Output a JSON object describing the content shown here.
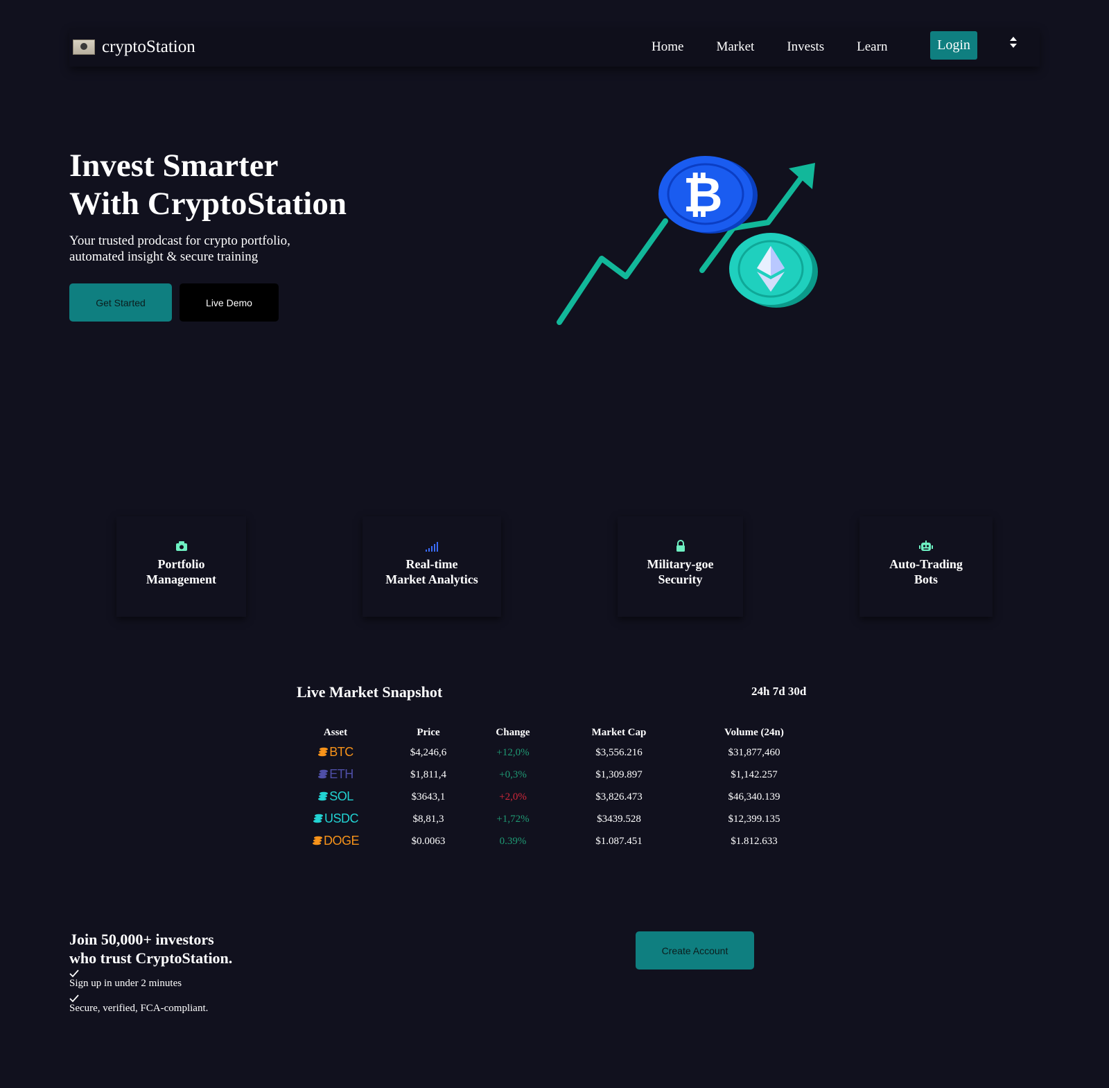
{
  "nav": {
    "brand": "cryptoStation",
    "links": [
      "Home",
      "Market",
      "Invests",
      "Learn"
    ],
    "login": "Login"
  },
  "hero": {
    "title_line1": "Invest Smarter",
    "title_line2": "With CryptoStation",
    "subtitle": "Your trusted prodcast for crypto portfolio, automated insight & secure training",
    "btn_started": "Get Started",
    "btn_demo": "Live Demo"
  },
  "features": [
    {
      "icon": "camera-icon",
      "line1": "Portfolio",
      "line2": "Management"
    },
    {
      "icon": "signal-bars-icon",
      "line1": "Real-time",
      "line2": "Market Analytics"
    },
    {
      "icon": "lock-icon",
      "line1": "Military-goe",
      "line2": "Security"
    },
    {
      "icon": "robot-icon",
      "line1": "Auto-Trading",
      "line2": "Bots"
    }
  ],
  "market": {
    "title": "Live Market Snapshot",
    "ranges": "24h 7d 30d",
    "headers": [
      "Asset",
      "Price",
      "Change",
      "Market Cap",
      "Volume (24n)"
    ],
    "rows": [
      {
        "asset": "BTC",
        "color": "#f7931a",
        "price": "$4,246,6",
        "change": "+12,0%",
        "dir": "pos",
        "mcap": "$3,556.216",
        "volume": "$31,877,460"
      },
      {
        "asset": "ETH",
        "color": "#4f4fa8",
        "price": "$1,811,4",
        "change": "+0,3%",
        "dir": "pos",
        "mcap": "$1,309.897",
        "volume": "$1,142.257"
      },
      {
        "asset": "SOL",
        "color": "#22d3d3",
        "price": "$3643,1",
        "change": "+2,0%",
        "dir": "neg",
        "mcap": "$3,826.473",
        "volume": "$46,340.139"
      },
      {
        "asset": "USDC",
        "color": "#22d3d3",
        "price": "$8,81,3",
        "change": "+1,72%",
        "dir": "pos",
        "mcap": "$3439.528",
        "volume": "$12,399.135"
      },
      {
        "asset": "DOGE",
        "color": "#f7931a",
        "price": "$0.0063",
        "change": "0.39%",
        "dir": "pos",
        "mcap": "$1.087.451",
        "volume": "$1.812.633"
      }
    ]
  },
  "cta": {
    "title_line1": "Join 50,000+ investors",
    "title_line2": "who trust CryptoStation.",
    "check1": "Sign up in under 2 minutes",
    "check2": "Secure, verified, FCA-compliant.",
    "btn_create": "Create Account"
  },
  "colors": {
    "background": "#11111e",
    "accent": "#0f7f80",
    "positive": "#1f9a74",
    "negative": "#d0283a",
    "icon_mint": "#6ef0c2",
    "icon_blue": "#3b6cff"
  }
}
